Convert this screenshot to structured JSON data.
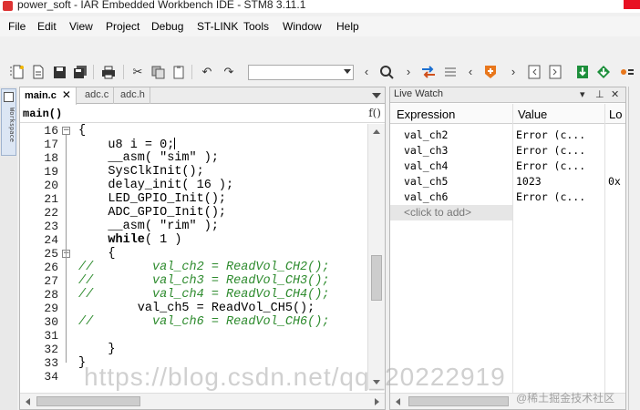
{
  "window": {
    "title": "power_soft - IAR Embedded Workbench IDE - STM8 3.11.1"
  },
  "menu": [
    "File",
    "Edit",
    "View",
    "Project",
    "Debug",
    "ST-LINK",
    "Tools",
    "Window",
    "Help"
  ],
  "toolbar": {
    "search_combo_value": ""
  },
  "workspace_tab": {
    "label": "Workspace"
  },
  "editor": {
    "tabs": [
      {
        "label": "main.c",
        "active": true
      },
      {
        "label": "adc.c",
        "active": false
      },
      {
        "label": "adc.h",
        "active": false
      }
    ],
    "function_selector": "main()",
    "function_icon": "f()",
    "lines": [
      {
        "n": "16",
        "text": "{",
        "fold": "minus",
        "comment": false
      },
      {
        "n": "17",
        "text": "    u8 i = 0;",
        "fold": "",
        "comment": false,
        "caret": true
      },
      {
        "n": "18",
        "text": "    __asm( \"sim\" );",
        "fold": "",
        "comment": false
      },
      {
        "n": "19",
        "text": "    SysClkInit();",
        "fold": "",
        "comment": false
      },
      {
        "n": "20",
        "text": "    delay_init( 16 );",
        "fold": "",
        "comment": false
      },
      {
        "n": "21",
        "text": "    LED_GPIO_Init();",
        "fold": "",
        "comment": false
      },
      {
        "n": "22",
        "text": "    ADC_GPIO_Init();",
        "fold": "",
        "comment": false
      },
      {
        "n": "23",
        "text": "    __asm( \"rim\" );",
        "fold": "",
        "comment": false
      },
      {
        "n": "24",
        "text": "    while( 1 )",
        "fold": "",
        "comment": false,
        "keyword": "while"
      },
      {
        "n": "25",
        "text": "    {",
        "fold": "minus",
        "comment": false
      },
      {
        "n": "26",
        "text": "//        val_ch2 = ReadVol_CH2();",
        "fold": "",
        "comment": true
      },
      {
        "n": "27",
        "text": "//        val_ch3 = ReadVol_CH3();",
        "fold": "",
        "comment": true
      },
      {
        "n": "28",
        "text": "//        val_ch4 = ReadVol_CH4();",
        "fold": "",
        "comment": true
      },
      {
        "n": "29",
        "text": "        val_ch5 = ReadVol_CH5();",
        "fold": "",
        "comment": false
      },
      {
        "n": "30",
        "text": "//        val_ch6 = ReadVol_CH6();",
        "fold": "",
        "comment": true
      },
      {
        "n": "31",
        "text": "",
        "fold": "",
        "comment": false
      },
      {
        "n": "32",
        "text": "    }",
        "fold": "",
        "comment": false
      },
      {
        "n": "33",
        "text": "}",
        "fold": "",
        "comment": false
      },
      {
        "n": "34",
        "text": "",
        "fold": "",
        "comment": false
      }
    ]
  },
  "live_watch": {
    "title": "Live Watch",
    "columns": [
      "Expression",
      "Value",
      "Lo"
    ],
    "rows": [
      {
        "expr": "val_ch2",
        "value": "Error (c...",
        "loc": ""
      },
      {
        "expr": "val_ch3",
        "value": "Error (c...",
        "loc": ""
      },
      {
        "expr": "val_ch4",
        "value": "Error (c...",
        "loc": ""
      },
      {
        "expr": "val_ch5",
        "value": "1023",
        "loc": "0x"
      },
      {
        "expr": "val_ch6",
        "value": "Error (c...",
        "loc": ""
      }
    ],
    "add_placeholder": "<click to add>"
  },
  "watermarks": {
    "main": "https://blog.csdn.net/qq_20222919",
    "corner": "@稀土掘金技术社区"
  },
  "colors": {
    "comment": "#2e8b2e",
    "accent_orange": "#e8771c",
    "accent_green": "#1e8f3c"
  }
}
